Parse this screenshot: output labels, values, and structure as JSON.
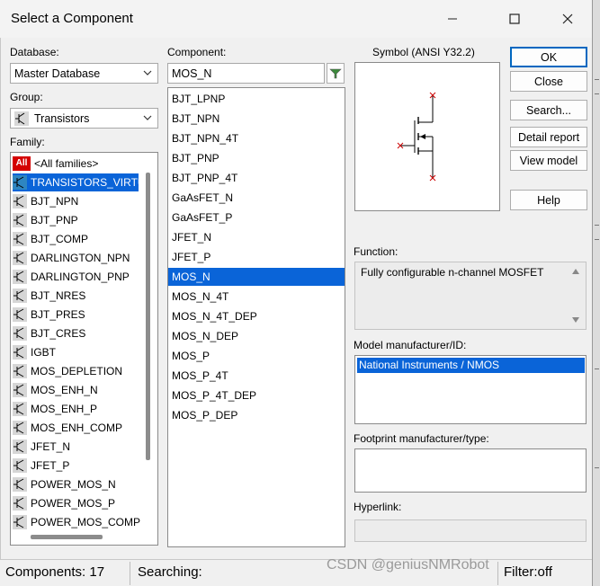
{
  "window": {
    "title": "Select a Component"
  },
  "left": {
    "database_label": "Database:",
    "database_value": "Master Database",
    "group_label": "Group:",
    "group_value": "Transistors",
    "family_label": "Family:",
    "families": [
      {
        "label": "<All families>",
        "icon": "all-families-icon"
      },
      {
        "label": "TRANSISTORS_VIRTUAL",
        "icon": "virtual-transistor-icon"
      },
      {
        "label": "BJT_NPN",
        "icon": "bjt-npn-icon"
      },
      {
        "label": "BJT_PNP",
        "icon": "bjt-pnp-icon"
      },
      {
        "label": "BJT_COMP",
        "icon": "bjt-comp-icon"
      },
      {
        "label": "DARLINGTON_NPN",
        "icon": "darlington-npn-icon"
      },
      {
        "label": "DARLINGTON_PNP",
        "icon": "darlington-pnp-icon"
      },
      {
        "label": "BJT_NRES",
        "icon": "bjt-nres-icon"
      },
      {
        "label": "BJT_PRES",
        "icon": "bjt-pres-icon"
      },
      {
        "label": "BJT_CRES",
        "icon": "bjt-cres-icon"
      },
      {
        "label": "IGBT",
        "icon": "igbt-icon"
      },
      {
        "label": "MOS_DEPLETION",
        "icon": "mos-depletion-icon"
      },
      {
        "label": "MOS_ENH_N",
        "icon": "mos-enh-n-icon"
      },
      {
        "label": "MOS_ENH_P",
        "icon": "mos-enh-p-icon"
      },
      {
        "label": "MOS_ENH_COMP",
        "icon": "mos-enh-comp-icon"
      },
      {
        "label": "JFET_N",
        "icon": "jfet-n-icon"
      },
      {
        "label": "JFET_P",
        "icon": "jfet-p-icon"
      },
      {
        "label": "POWER_MOS_N",
        "icon": "power-mos-n-icon"
      },
      {
        "label": "POWER_MOS_P",
        "icon": "power-mos-p-icon"
      },
      {
        "label": "POWER_MOS_COMP",
        "icon": "power-mos-comp-icon"
      }
    ],
    "all_badge": "All"
  },
  "middle": {
    "component_label": "Component:",
    "component_value": "MOS_N",
    "components": [
      "BJT_LPNP",
      "BJT_NPN",
      "BJT_NPN_4T",
      "BJT_PNP",
      "BJT_PNP_4T",
      "GaAsFET_N",
      "GaAsFET_P",
      "JFET_N",
      "JFET_P",
      "MOS_N",
      "MOS_N_4T",
      "MOS_N_4T_DEP",
      "MOS_N_DEP",
      "MOS_P",
      "MOS_P_4T",
      "MOS_P_4T_DEP",
      "MOS_P_DEP"
    ],
    "selected": "MOS_N"
  },
  "right": {
    "symbol_label": "Symbol (ANSI Y32.2)",
    "function_label": "Function:",
    "function_text": "Fully configurable n-channel MOSFET",
    "model_label": "Model manufacturer/ID:",
    "model_value": "National Instruments / NMOS",
    "footprint_label": "Footprint manufacturer/type:",
    "hyperlink_label": "Hyperlink:"
  },
  "buttons": {
    "ok": "OK",
    "close": "Close",
    "search": "Search...",
    "detail_report": "Detail report",
    "view_model": "View model",
    "help": "Help"
  },
  "status": {
    "components": "Components: 17",
    "searching": "Searching:",
    "filter": "Filter:off",
    "watermark": "CSDN @geniusNMRobot"
  },
  "colors": {
    "selection": "#0a64d8",
    "accent": "#0067c0",
    "symbol_mark": "#cc0000"
  }
}
